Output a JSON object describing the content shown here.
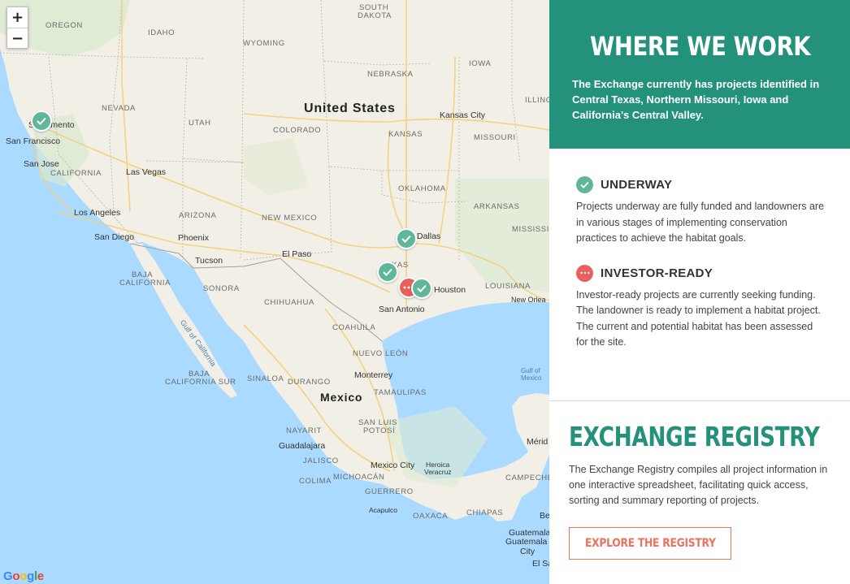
{
  "map": {
    "zoom_in_label": "+",
    "zoom_out_label": "−",
    "attribution": "Google",
    "labels": {
      "south_dakota_1": "SOUTH",
      "south_dakota_2": "DAKOTA",
      "oregon": "OREGON",
      "idaho": "IDAHO",
      "wyoming": "WYOMING",
      "nebraska": "NEBRASKA",
      "iowa": "IOWA",
      "illinois": "ILLINOIS",
      "nevada": "NEVADA",
      "utah": "UTAH",
      "colorado": "COLORADO",
      "kansas": "KANSAS",
      "missouri": "MISSOURI",
      "california": "CALIFORNIA",
      "arizona": "ARIZONA",
      "new_mexico": "NEW MEXICO",
      "oklahoma": "OKLAHOMA",
      "arkansas": "ARKANSAS",
      "mississippi": "MISSISSI",
      "texas": "XAS",
      "louisiana": "LOUISIANA",
      "baja_california_1": "BAJA",
      "baja_california_2": "CALIFORNIA",
      "sonora": "SONORA",
      "chihuahua": "CHIHUAHUA",
      "coahuila": "COAHUILA",
      "nuevo_leon": "NUEVO LEÓN",
      "baja_california_sur_1": "BAJA",
      "baja_california_sur_2": "CALIFORNIA SUR",
      "sinaloa": "SINALOA",
      "durango": "DURANGO",
      "tamaulipas": "TAMAULIPAS",
      "nayarit": "NAYARIT",
      "san_luis_potosi_1": "SAN LUIS",
      "san_luis_potosi_2": "POTOSÍ",
      "jalisco": "JALISCO",
      "michoacan": "MICHOACÁN",
      "colima": "COLIMA",
      "guerrero": "GUERRERO",
      "oaxaca": "OAXACA",
      "chiapas": "CHIAPAS",
      "campeche": "CAMPECHE",
      "united_states": "United States",
      "mexico": "Mexico",
      "sacramento": "Sacramento",
      "san_francisco": "San Francisco",
      "san_jose": "San Jose",
      "las_vegas": "Las Vegas",
      "los_angeles": "Los Angeles",
      "san_diego": "San Diego",
      "phoenix": "Phoenix",
      "tucson": "Tucson",
      "el_paso": "El Paso",
      "kansas_city": "Kansas City",
      "dallas": "Dallas",
      "houston": "Houston",
      "san_antonio": "San Antonio",
      "new_orleans": "New Orlea",
      "monterrey": "Monterrey",
      "guadalajara": "Guadalajara",
      "mexico_city": "Mexico City",
      "heroica_veracruz_1": "Heroica",
      "heroica_veracruz_2": "Veracruz",
      "acapulco": "Acapulco",
      "merida": "Mérid",
      "guatemala": "Guatemala",
      "guatemala_city_1": "Guatemala",
      "guatemala_city_2": "City",
      "el_salvador": "El Sa",
      "belize": "Be",
      "gulf_of_california_1": "Gulf of",
      "gulf_of_california_2": "California",
      "gulf_of_mexico_1": "Gulf of",
      "gulf_of_mexico_2": "Mexico"
    }
  },
  "panel": {
    "heading": "WHERE WE WORK",
    "intro": "The Exchange currently has projects identified in Central Texas, Northern Missouri, Iowa and California's Central Valley.",
    "legend": [
      {
        "title": "UNDERWAY",
        "description": "Projects underway are fully funded and landowners are in various stages of implementing conservation practices to achieve the habitat goals."
      },
      {
        "title": "INVESTOR-READY",
        "description": "Investor-ready projects are currently seeking funding. The landowner is ready to implement a habitat project. The current and potential habitat has been assessed for the site."
      }
    ],
    "registry": {
      "heading": "EXCHANGE REGISTRY",
      "description": "The Exchange Registry compiles all project information in one interactive spreadsheet, facilitating quick access, sorting and summary reporting of projects.",
      "button_label": "EXPLORE THE REGISTRY"
    }
  },
  "colors": {
    "brand_teal": "#24917a",
    "underway_green": "#5fb79a",
    "investor_red": "#e8615e",
    "button_orange": "#e8735e"
  }
}
